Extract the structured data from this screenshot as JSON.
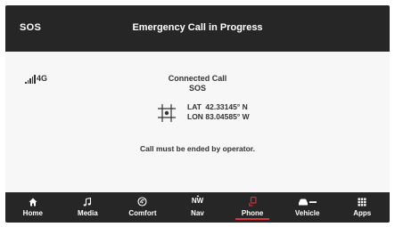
{
  "header": {
    "sos_label": "SOS",
    "title": "Emergency Call in Progress"
  },
  "status": {
    "network": "4G",
    "signal_level": 5
  },
  "call": {
    "status": "Connected Call",
    "type": "SOS",
    "lat_label": "LAT",
    "lat_value": "42.33145° N",
    "lon_label": "LON",
    "lon_value": "83.04585° W",
    "note": "Call must be ended by operator."
  },
  "nav": {
    "items": [
      {
        "label": "Home",
        "icon": "home-icon"
      },
      {
        "label": "Media",
        "icon": "music-note-icon"
      },
      {
        "label": "Comfort",
        "icon": "climate-icon"
      },
      {
        "label": "Nav",
        "icon": "compass-icon",
        "icon_text": "NW"
      },
      {
        "label": "Phone",
        "icon": "phone-icon",
        "active": true
      },
      {
        "label": "Vehicle",
        "icon": "car-icon"
      },
      {
        "label": "Apps",
        "icon": "apps-grid-icon"
      }
    ]
  },
  "colors": {
    "bar_background": "#262626",
    "accent": "#e0303a",
    "content_background": "#f7f7f7"
  }
}
